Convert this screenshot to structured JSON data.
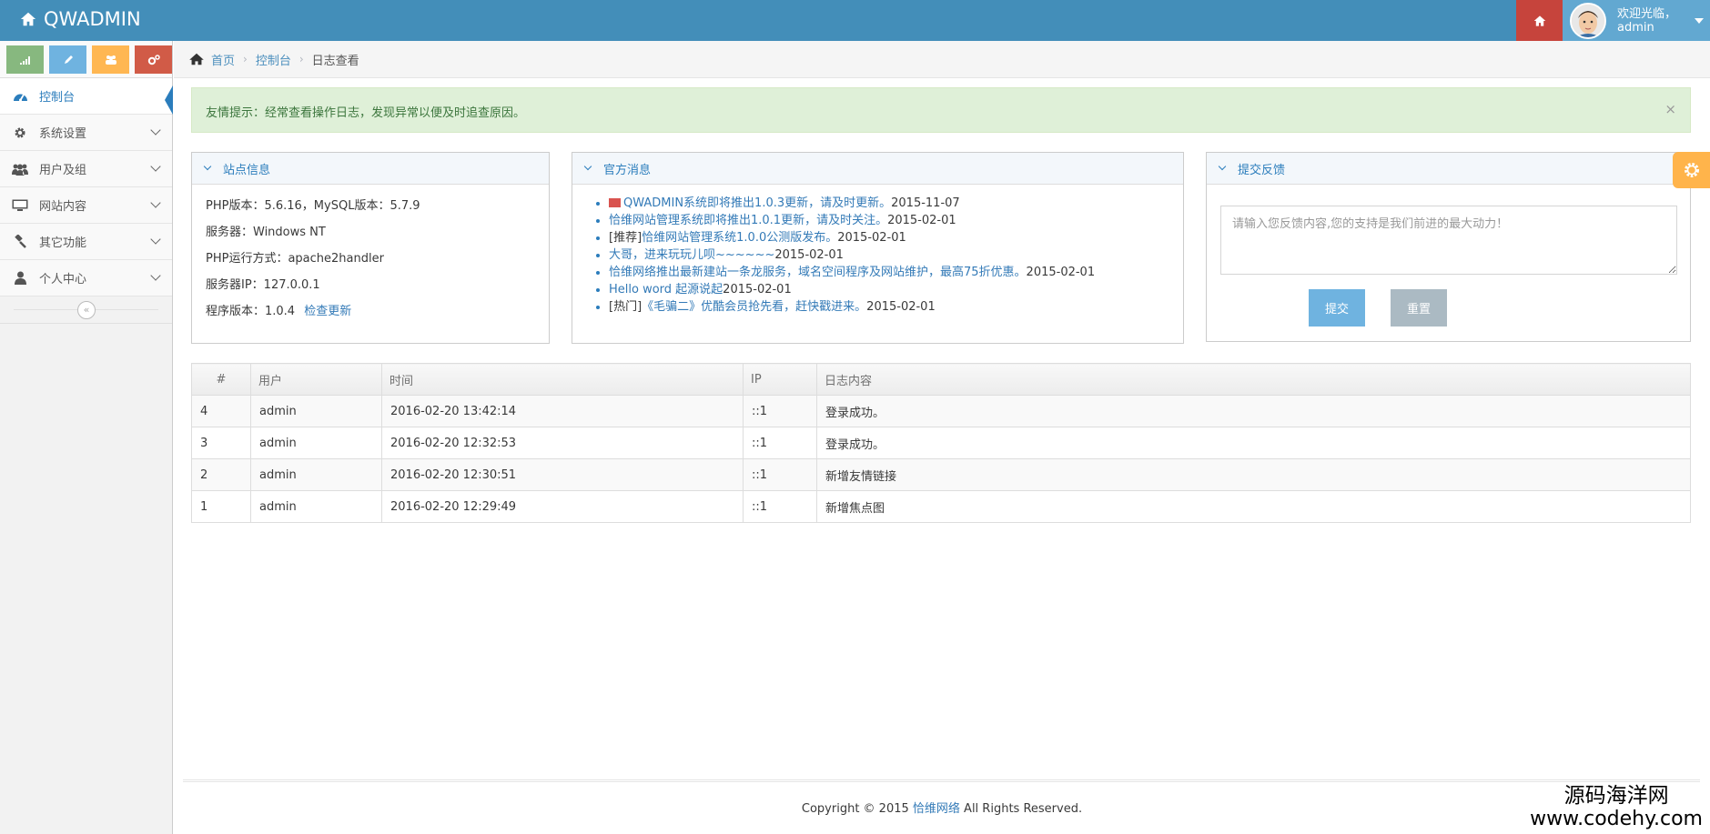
{
  "navbar": {
    "brand": "QWADMIN",
    "welcome": "欢迎光临，",
    "username": "admin"
  },
  "sidebar": {
    "shortcuts": [
      "signal-icon",
      "pencil-icon",
      "users-icon",
      "cogs-icon"
    ],
    "items": [
      {
        "label": "控制台",
        "icon": "tachometer-icon",
        "active": true
      },
      {
        "label": "系统设置",
        "icon": "cog-icon"
      },
      {
        "label": "用户及组",
        "icon": "users-icon"
      },
      {
        "label": "网站内容",
        "icon": "desktop-icon"
      },
      {
        "label": "其它功能",
        "icon": "gavel-icon"
      },
      {
        "label": "个人中心",
        "icon": "user-icon"
      }
    ],
    "collapse_glyph": "«"
  },
  "breadcrumb": {
    "home": "首页",
    "dashboard": "控制台",
    "current": "日志查看"
  },
  "alert": {
    "text": "友情提示：经常查看操作日志，发现异常以便及时追查原因。",
    "close": "×"
  },
  "site_info": {
    "title": "站点信息",
    "lines": [
      "PHP版本：5.6.16，MySQL版本：5.7.9",
      "服务器：Windows NT",
      "PHP运行方式：apache2handler",
      "服务器IP：127.0.0.1"
    ],
    "version_label": "程序版本：1.0.4",
    "check_update": "检查更新"
  },
  "official_news": {
    "title": "官方消息",
    "items": [
      {
        "prefix": "",
        "link": "QWADMIN系统即将推出1.0.3更新，请及时更新。",
        "date": "2015-11-07",
        "flag": true
      },
      {
        "prefix": "",
        "link": "恰维网站管理系统即将推出1.0.1更新，请及时关注。",
        "date": "2015-02-01"
      },
      {
        "prefix": "[推荐]",
        "link": "恰维网站管理系统1.0.0公测版发布。",
        "date": "2015-02-01"
      },
      {
        "prefix": "",
        "link": "大哥，进来玩玩儿呗~~~~~~",
        "date": "2015-02-01"
      },
      {
        "prefix": "",
        "link": "恰维网络推出最新建站一条龙服务，域名空间程序及网站维护，最高75折优惠。",
        "date": "2015-02-01"
      },
      {
        "prefix": "",
        "link": "Hello word 起源说起",
        "date": "2015-02-01"
      },
      {
        "prefix": "[热门]",
        "link": "《毛骗二》优酷会员抢先看，赶快戳进来。",
        "date": "2015-02-01"
      }
    ]
  },
  "feedback": {
    "title": "提交反馈",
    "placeholder": "请输入您反馈内容,您的支持是我们前进的最大动力！",
    "submit": "提交",
    "reset": "重置"
  },
  "log_table": {
    "headers": [
      "#",
      "用户",
      "时间",
      "IP",
      "日志内容"
    ],
    "rows": [
      [
        "4",
        "admin",
        "2016-02-20 13:42:14",
        "::1",
        "登录成功。"
      ],
      [
        "3",
        "admin",
        "2016-02-20 12:32:53",
        "::1",
        "登录成功。"
      ],
      [
        "2",
        "admin",
        "2016-02-20 12:30:51",
        "::1",
        "新增友情链接"
      ],
      [
        "1",
        "admin",
        "2016-02-20 12:29:49",
        "::1",
        "新增焦点图"
      ]
    ]
  },
  "footer": {
    "prefix": "Copyright © 2015 ",
    "company": "恰维网络",
    "suffix": " All Rights Reserved."
  },
  "watermark": {
    "line1": "源码海洋网",
    "line2": "www.codehy.com"
  },
  "colors": {
    "navbar": "#438eb9",
    "home_button": "#c6443c",
    "user_area": "#62a8d1",
    "accent": "#2b7dbc",
    "alert_bg": "#dff0d8"
  }
}
